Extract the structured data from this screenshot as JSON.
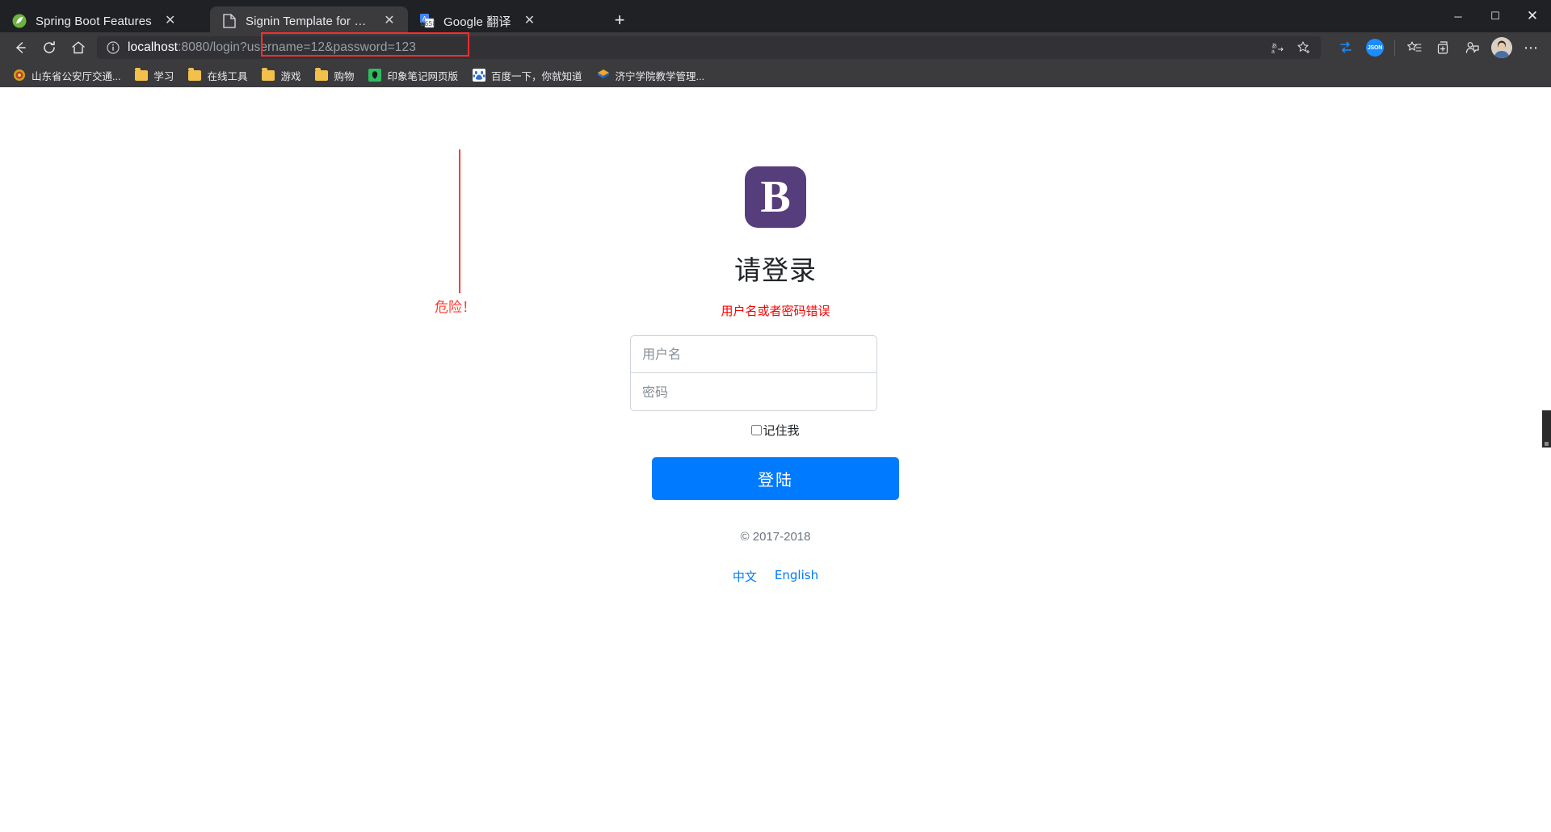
{
  "window": {
    "controls": {
      "minimize": "─",
      "maximize": "☐",
      "close": "✕"
    }
  },
  "tabs": [
    {
      "title": "Spring Boot Features",
      "icon": "spring-leaf-icon",
      "close": "✕",
      "active": false
    },
    {
      "title": "Signin Template for Bootstrap",
      "icon": "page-document-icon",
      "close": "✕",
      "active": true
    },
    {
      "title": "Google 翻译",
      "icon": "google-translate-icon",
      "close": "✕",
      "active": false
    }
  ],
  "newtab_label": "+",
  "nav": {
    "back": "←",
    "forward": "→",
    "refresh": "↻",
    "home": "⌂"
  },
  "address": {
    "security_icon": "info-circle-icon",
    "host": "localhost",
    "rest": ":8080/login",
    "query": "?username=12&password=123",
    "full_url": "localhost:8080/login?username=12&password=123",
    "highlight_color": "#ff2d2d",
    "actions": [
      {
        "name": "translate-icon",
        "glyph": "文"
      },
      {
        "name": "favorite-star-icon",
        "glyph": "☆"
      }
    ]
  },
  "toolbar": [
    {
      "name": "collections-sync-icon",
      "glyph": "⇆"
    },
    {
      "name": "json-viewer-icon",
      "glyph": "JSON"
    },
    {
      "name": "favorites-list-icon",
      "glyph": "☆"
    },
    {
      "name": "collections-icon",
      "glyph": "⧉"
    },
    {
      "name": "profile-feedback-icon",
      "glyph": "☺"
    },
    {
      "name": "account-avatar",
      "glyph": ""
    },
    {
      "name": "settings-more-icon",
      "glyph": "⋯"
    }
  ],
  "bookmarks": [
    {
      "label": "山东省公安厅交通...",
      "icon": "police-badge-icon"
    },
    {
      "label": "学习",
      "icon": "folder-icon"
    },
    {
      "label": "在线工具",
      "icon": "folder-icon"
    },
    {
      "label": "游戏",
      "icon": "folder-icon"
    },
    {
      "label": "购物",
      "icon": "folder-icon"
    },
    {
      "label": "印象笔记网页版",
      "icon": "evernote-icon"
    },
    {
      "label": "百度一下，你就知道",
      "icon": "baidu-icon"
    },
    {
      "label": "济宁学院教学管理...",
      "icon": "jnxy-icon"
    }
  ],
  "annotation": {
    "label": "危险！",
    "color": "#ff3b30"
  },
  "page": {
    "logo_letter": "B",
    "logo_color": "#563d7c",
    "title": "请登录",
    "error": "用户名或者密码错误",
    "error_color": "#ff0000",
    "username_placeholder": "用户名",
    "username_value": "",
    "password_placeholder": "密码",
    "password_value": "",
    "remember_label": "记住我",
    "submit_label": "登陆",
    "submit_color": "#007bff",
    "copyright": "© 2017-2018",
    "lang_zh": "中文",
    "lang_en": "English"
  }
}
